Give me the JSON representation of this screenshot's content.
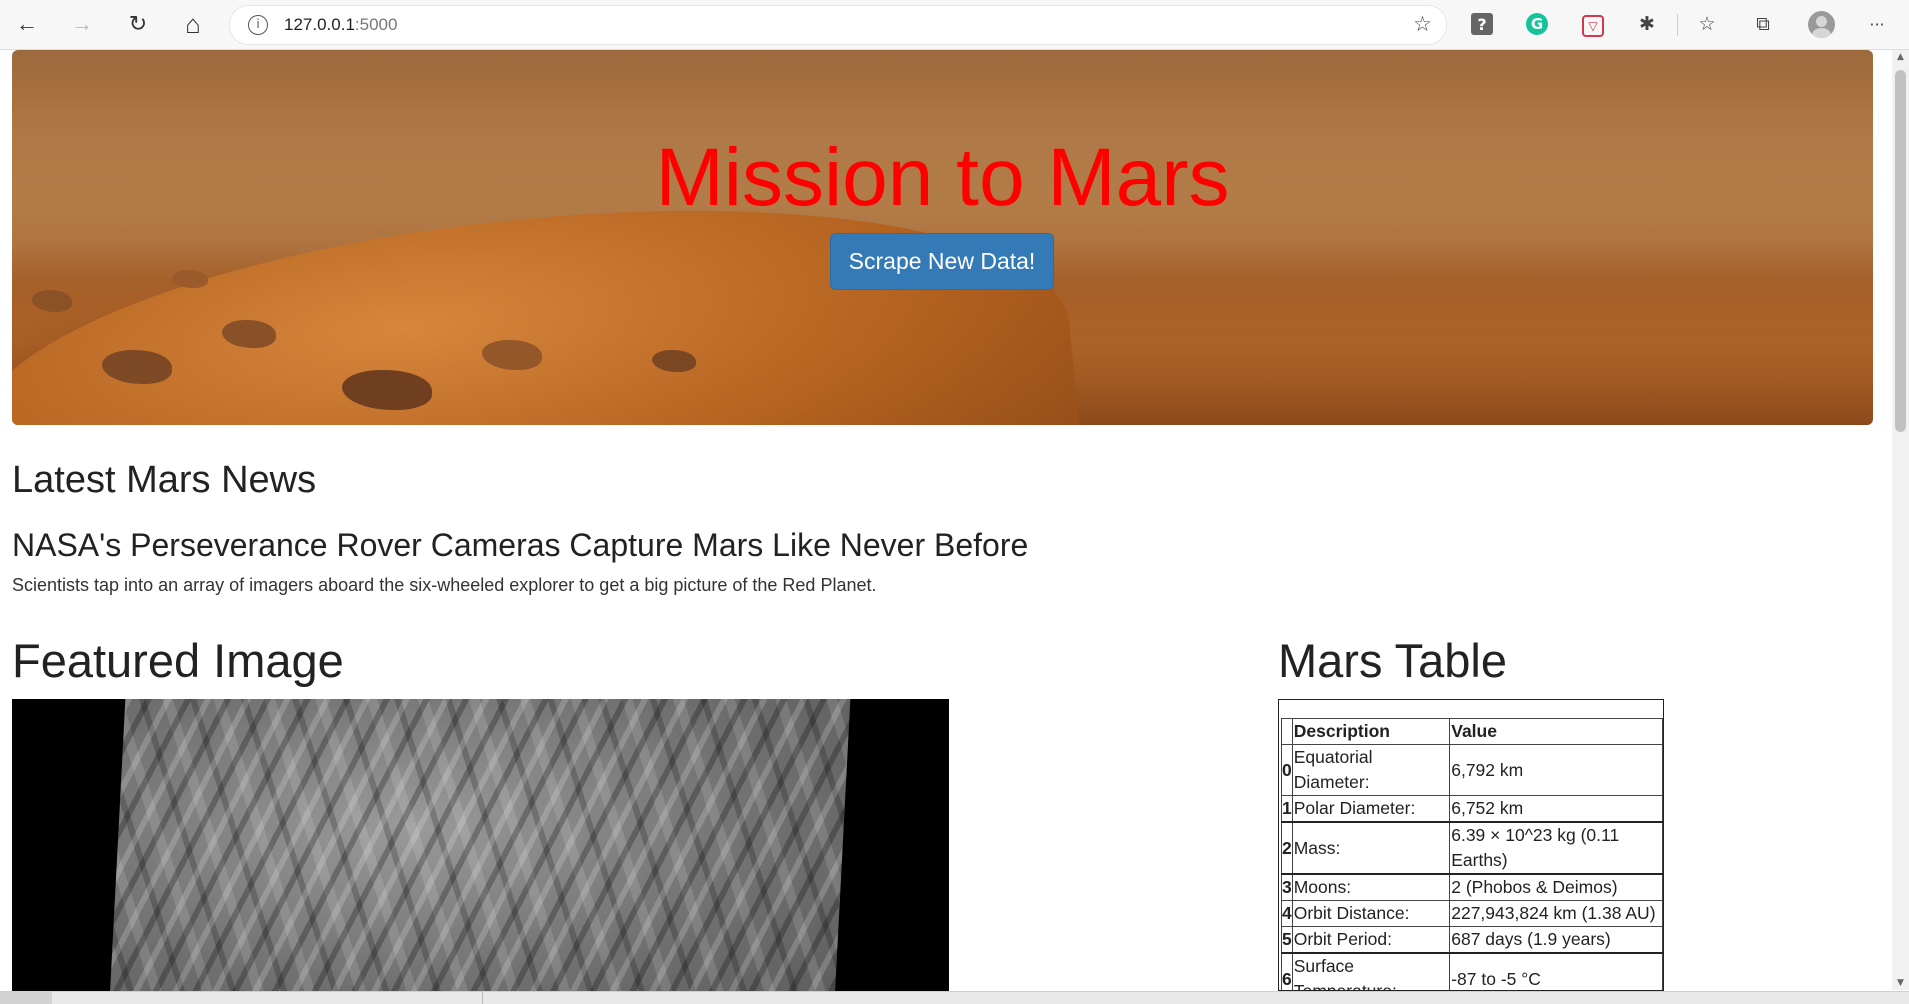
{
  "browser": {
    "url_host": "127.0.0.1",
    "url_port": ":5000",
    "icons": {
      "back": "back-arrow-icon",
      "forward": "forward-arrow-icon",
      "refresh": "refresh-icon",
      "home": "home-icon",
      "info": "info-icon",
      "add_favorite": "add-favorite-icon",
      "help_extension": "help-extension-icon",
      "grammarly": "grammarly-icon",
      "pocket": "pocket-icon",
      "extensions": "puzzle-icon",
      "favorites": "favorites-icon",
      "collections": "collections-icon",
      "profile": "profile-avatar-icon",
      "more": "more-icon"
    },
    "glyphs": {
      "back": "←",
      "forward": "→",
      "refresh": "↻",
      "home": "⌂",
      "info": "i",
      "add_favorite": "☆",
      "help": "?",
      "grammarly": "G",
      "pocket": "▽",
      "extensions": "✱",
      "favorites": "☆",
      "collections": "⧉",
      "more": "···"
    }
  },
  "hero": {
    "title": "Mission to Mars",
    "button_label": "Scrape New Data!",
    "title_color": "#ff0000",
    "button_color": "#337ab7"
  },
  "news": {
    "heading": "Latest Mars News",
    "title": "NASA's Perseverance Rover Cameras Capture Mars Like Never Before",
    "teaser": "Scientists tap into an array of imagers aboard the six-wheeled explorer to get a big picture of the Red Planet."
  },
  "featured": {
    "heading": "Featured Image"
  },
  "mars_table": {
    "heading": "Mars Table",
    "columns": [
      "Description",
      "Value"
    ],
    "rows": [
      {
        "index": "0",
        "description": "Equatorial Diameter:",
        "value": "6,792 km"
      },
      {
        "index": "1",
        "description": "Polar Diameter:",
        "value": "6,752 km"
      },
      {
        "index": "2",
        "description": "Mass:",
        "value": "6.39 × 10^23 kg (0.11 Earths)"
      },
      {
        "index": "3",
        "description": "Moons:",
        "value": "2 (Phobos & Deimos)"
      },
      {
        "index": "4",
        "description": "Orbit Distance:",
        "value": "227,943,824 km (1.38 AU)"
      },
      {
        "index": "5",
        "description": "Orbit Period:",
        "value": "687 days (1.9 years)"
      },
      {
        "index": "6",
        "description": "Surface Temperature:",
        "value": "-87 to -5 °C"
      }
    ]
  }
}
